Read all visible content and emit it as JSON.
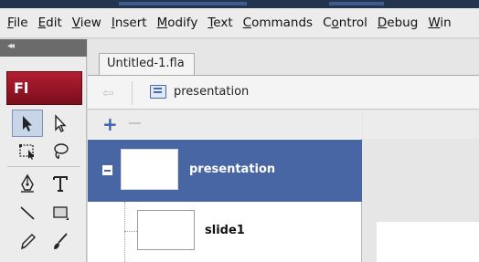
{
  "menu": {
    "items": [
      {
        "u": "F",
        "rest": "ile"
      },
      {
        "u": "E",
        "rest": "dit"
      },
      {
        "u": "V",
        "rest": "iew"
      },
      {
        "u": "I",
        "rest": "nsert"
      },
      {
        "u": "M",
        "rest": "odify"
      },
      {
        "u": "T",
        "rest": "ext"
      },
      {
        "u": "C",
        "rest": "ommands"
      },
      {
        "pre": "C",
        "u": "o",
        "rest": "ntrol"
      },
      {
        "u": "D",
        "rest": "ebug"
      },
      {
        "u": "W",
        "rest": "in"
      }
    ]
  },
  "tools": {
    "collapse_glyph": "◂◂",
    "app_badge": "Fl",
    "items": [
      "selection-tool",
      "subselection-tool",
      "free-transform-tool",
      "lasso-tool",
      "pen-tool",
      "text-tool",
      "line-tool",
      "rectangle-tool",
      "pencil-tool",
      "brush-tool"
    ]
  },
  "document": {
    "tab_label": "Untitled-1.fla",
    "breadcrumb": "presentation"
  },
  "screens": {
    "toggle": "−",
    "add": "+",
    "root": {
      "label": "presentation",
      "expanded": true,
      "selected": true
    },
    "children": [
      {
        "label": "slide1"
      }
    ]
  },
  "colors": {
    "selection": "#4766a3",
    "brand": "#a01829",
    "accent": "#3b64a8"
  }
}
